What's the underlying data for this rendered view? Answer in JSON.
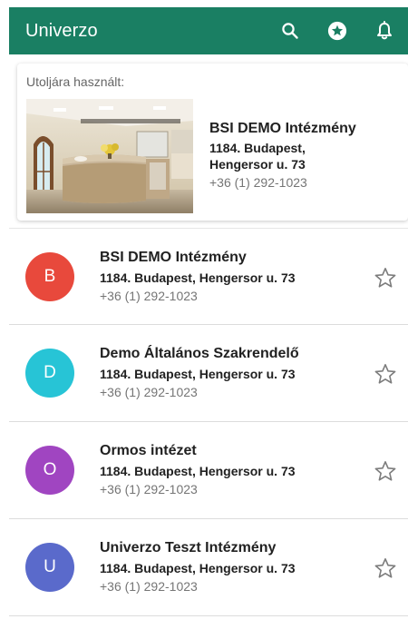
{
  "appbar": {
    "title": "Univerzo",
    "background": "#1a7f63",
    "icons": [
      "search-icon",
      "star-circle-icon",
      "bell-icon"
    ]
  },
  "recent": {
    "label": "Utoljára használt:",
    "name": "BSI DEMO Intézmény",
    "address_line1": "1184. Budapest,",
    "address_line2": "Hengersor u. 73",
    "phone": "+36 (1) 292-1023"
  },
  "institutions": [
    {
      "initial": "B",
      "color": "#e8493c",
      "name": "BSI DEMO Intézmény",
      "address": "1184. Budapest, Hengersor u. 73",
      "phone": "+36 (1) 292-1023"
    },
    {
      "initial": "D",
      "color": "#27c4d6",
      "name": "Demo Általános Szakrendelő",
      "address": "1184. Budapest, Hengersor u. 73",
      "phone": "+36 (1) 292-1023"
    },
    {
      "initial": "O",
      "color": "#a045c1",
      "name": "Ormos intézet",
      "address": "1184. Budapest, Hengersor u. 73",
      "phone": "+36 (1) 292-1023"
    },
    {
      "initial": "U",
      "color": "#5a6acb",
      "name": "Univerzo Teszt Intézmény",
      "address": "1184. Budapest, Hengersor u. 73",
      "phone": "+36 (1) 292-1023"
    }
  ]
}
